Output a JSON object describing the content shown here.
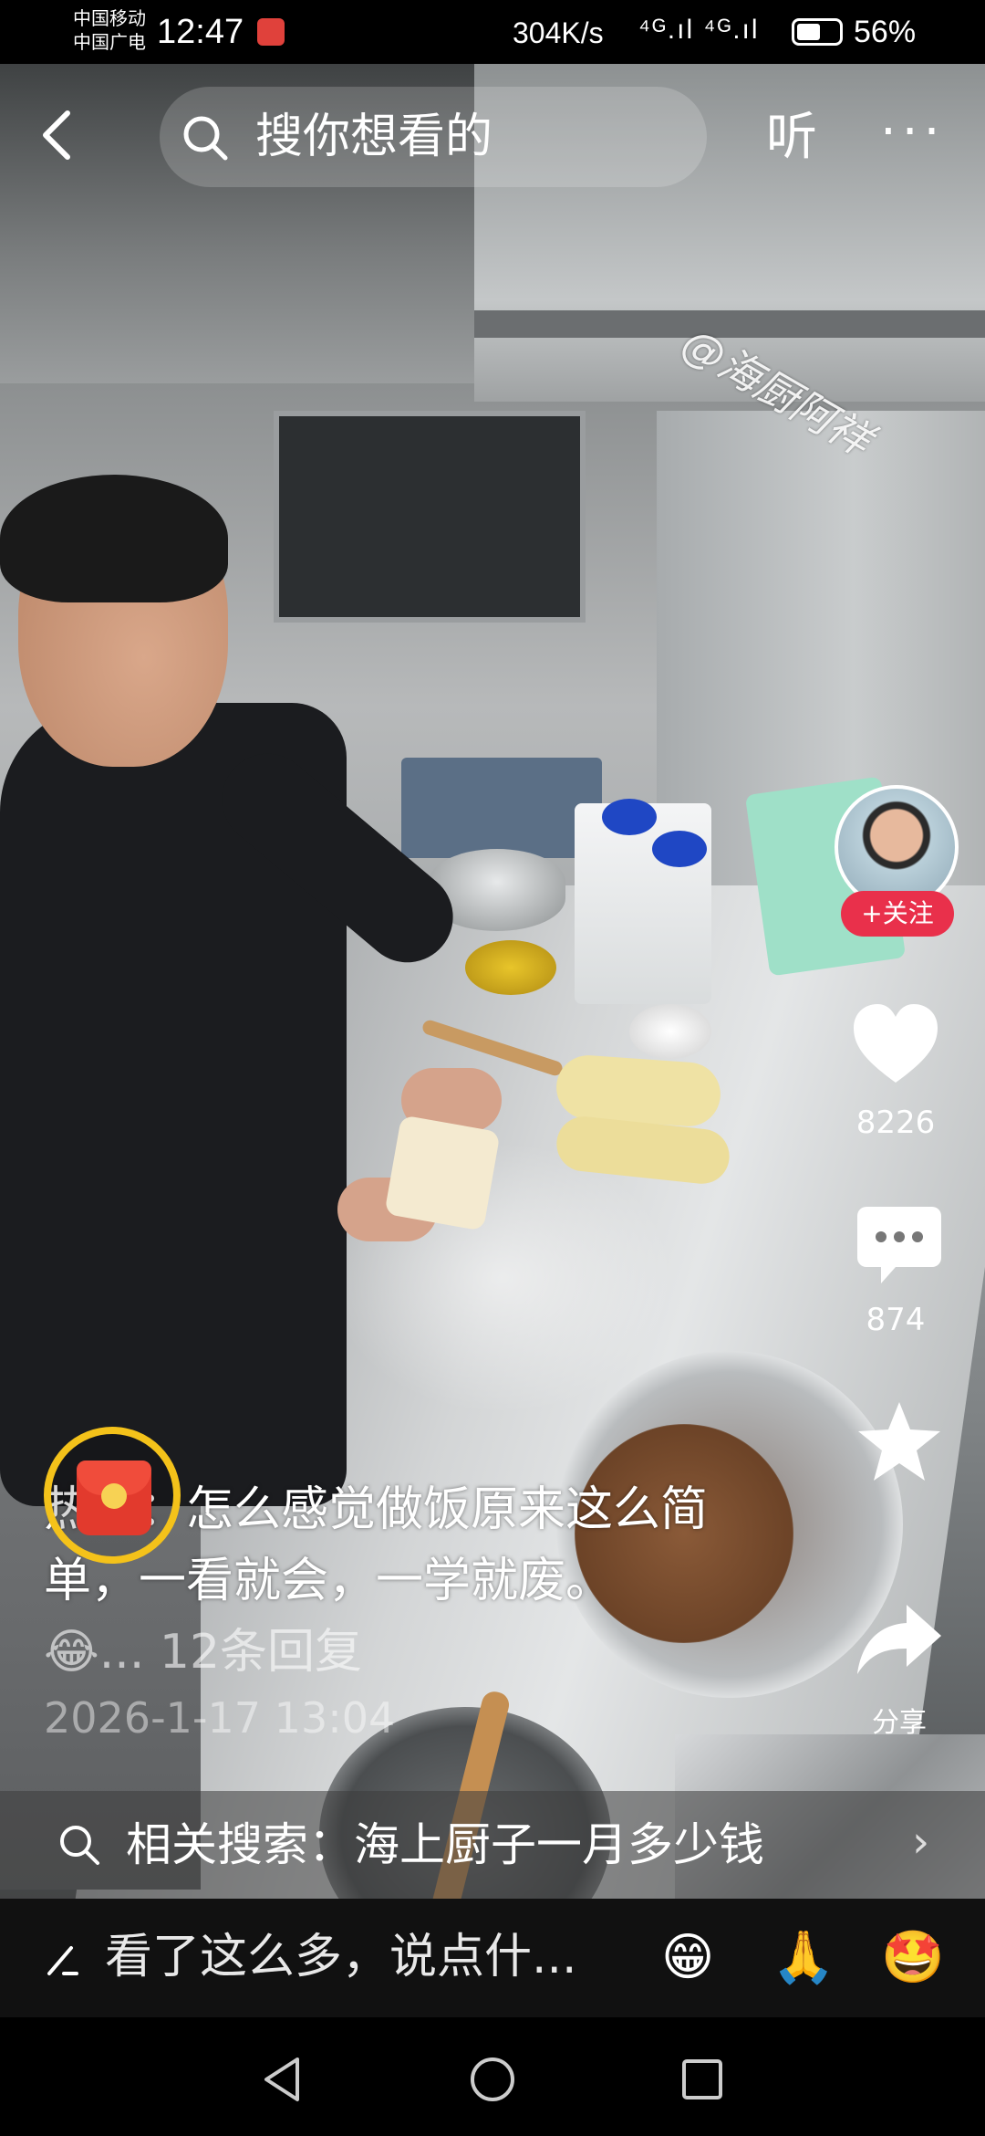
{
  "status_bar": {
    "carrier_1": "中国移动",
    "carrier_2": "中国广电",
    "time": "12:47",
    "speed": "304K/s",
    "signal": "⁴ᴳ.ıl ⁴ᴳ.ıl",
    "battery": "56%",
    "battery_level": 0.56
  },
  "top_bar": {
    "search_placeholder": "搜你想看的",
    "listen_label": "听",
    "more_label": "···"
  },
  "video": {
    "watermark": "@海厨阿祥"
  },
  "right_rail": {
    "follow_label": "+关注",
    "likes": "8226",
    "comments": "874",
    "share_label": "分享"
  },
  "comment_overlay": {
    "text": "热评：怎么感觉做饭原来这么简单，一看就会，一学就废。",
    "reply_line": "😂... 12条回复",
    "date": "2026-1-17 13:04"
  },
  "related_search": {
    "text": "相关搜索：海上厨子一月多少钱"
  },
  "comment_input": {
    "placeholder": "看了这么多，说点什...",
    "emoji_1": "😁",
    "emoji_2": "🙏",
    "emoji_3": "🤩"
  },
  "colors": {
    "follow_red": "#e9304b",
    "redpack_ring": "#f4c21a",
    "redpack": "#e23a2d"
  }
}
